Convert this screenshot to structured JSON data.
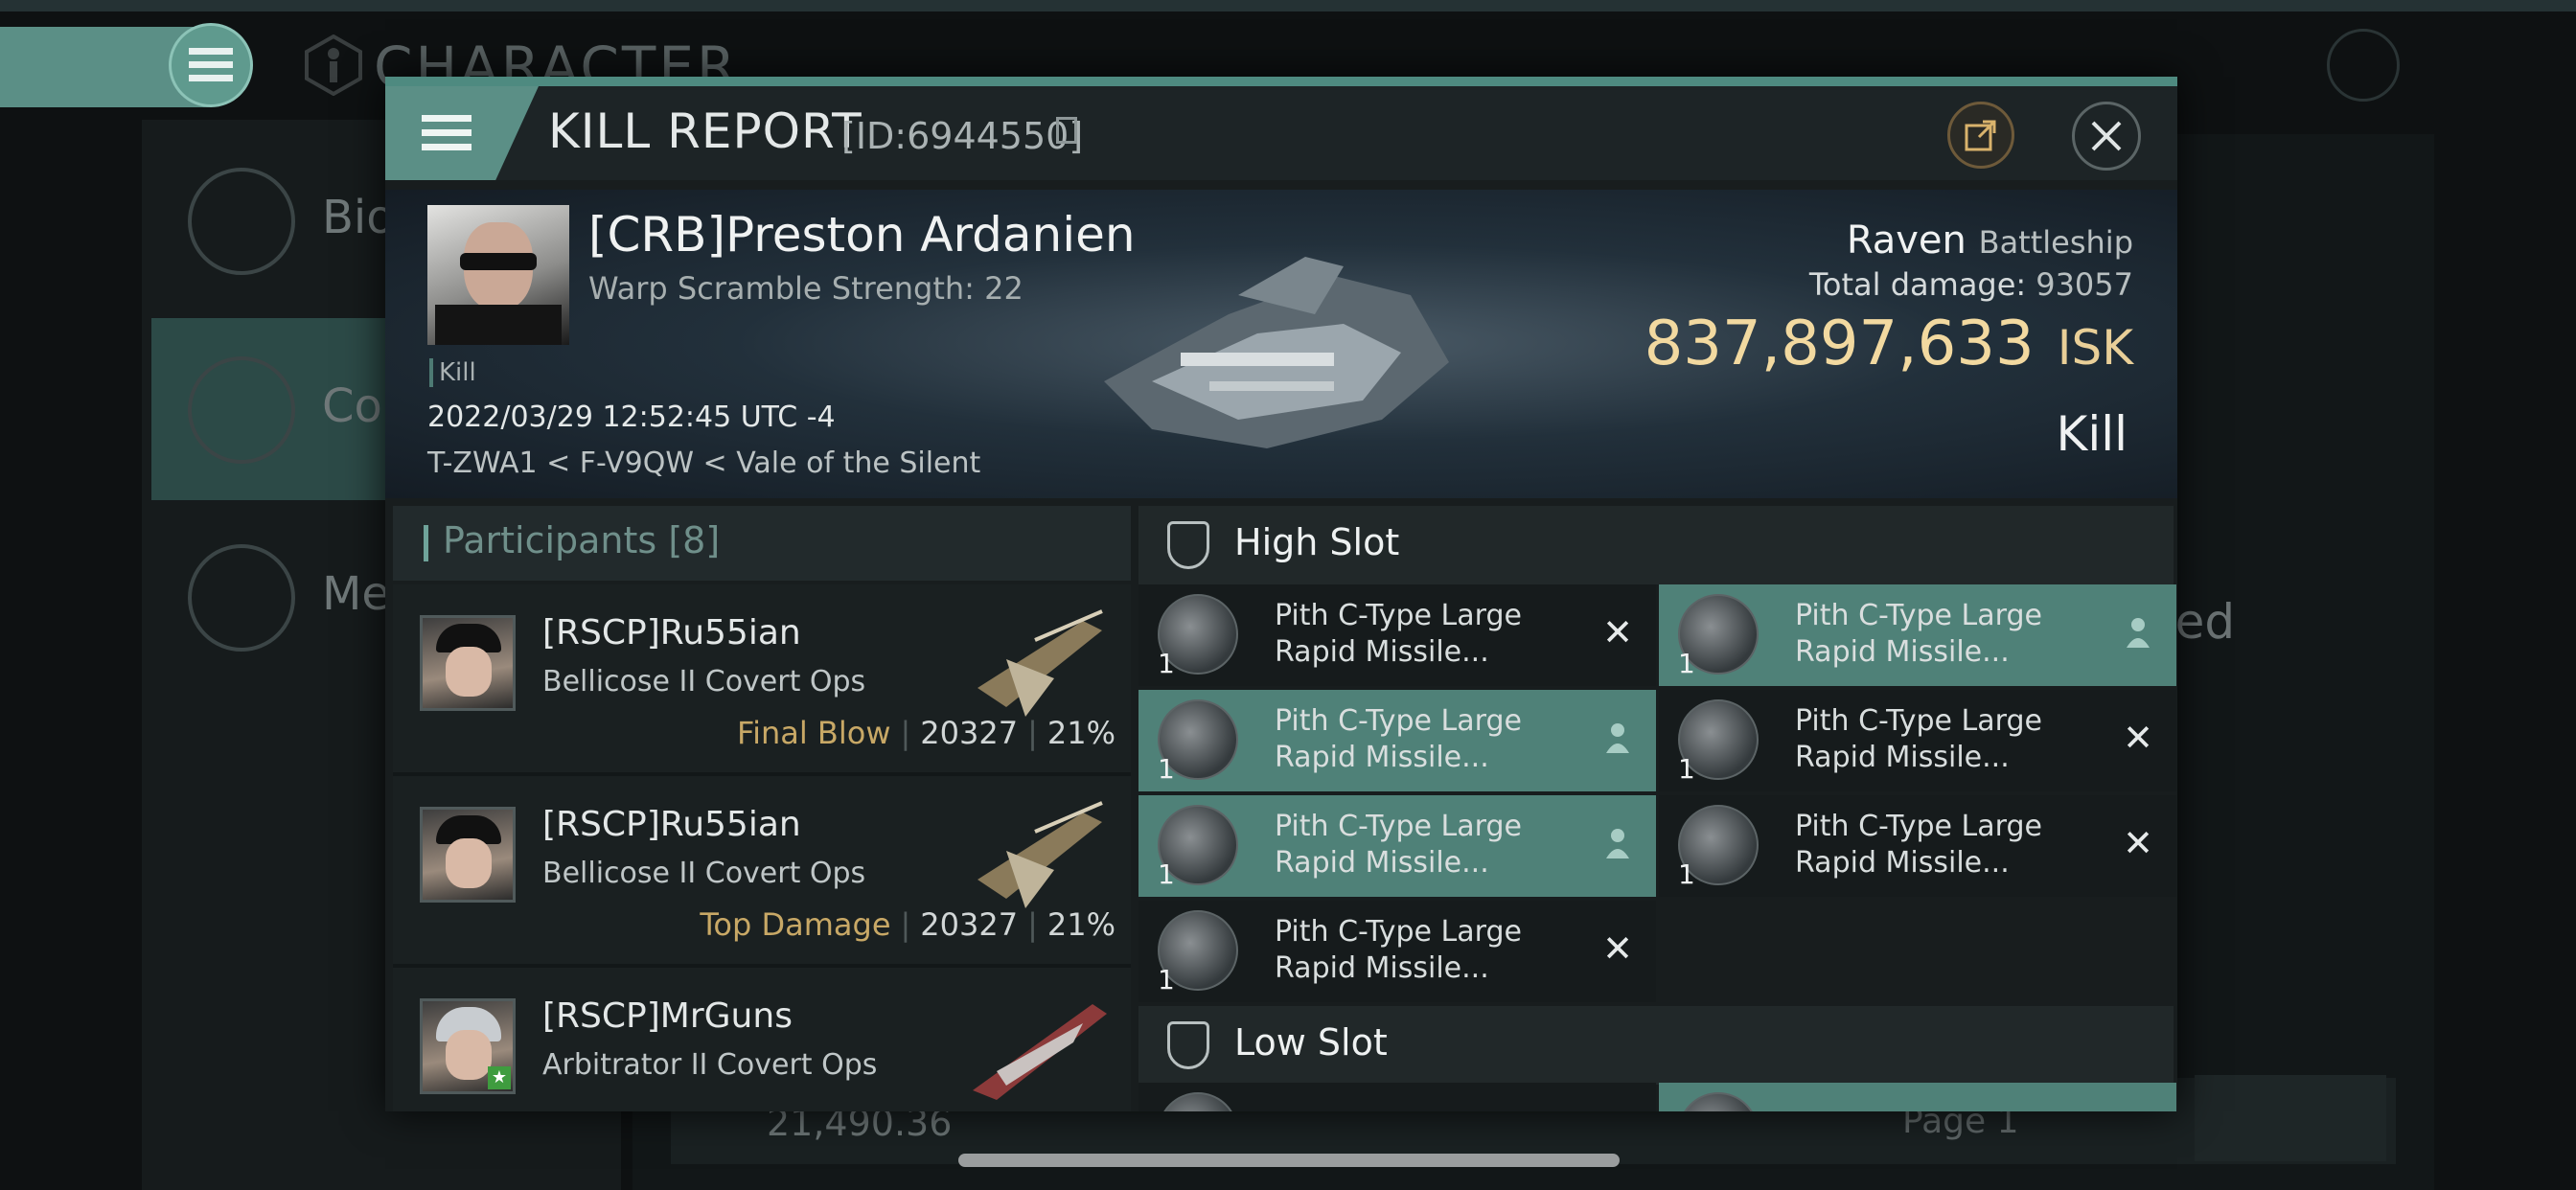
{
  "background": {
    "title": "CHARACTER",
    "sidebar": [
      {
        "label": "Bio"
      },
      {
        "label": "Co"
      },
      {
        "label": "Me"
      }
    ],
    "main_text": "ted",
    "balance": "21,490.36",
    "page": "Page 1"
  },
  "kill_report": {
    "title": "KILL REPORT",
    "id": "[ID:6944550]",
    "victim": {
      "name": "[CRB]Preston Ardanien",
      "warp_scramble": "Warp Scramble Strength: 22",
      "tag": "Kill",
      "date": "2022/03/29 12:52:45 UTC -4",
      "location": "T-ZWA1 < F-V9QW < Vale of the Silent",
      "ship": "Raven",
      "ship_class": "Battleship",
      "total_damage_label": "Total damage:",
      "total_damage": "93057",
      "isk_value": "837,897,633",
      "isk_unit": "ISK",
      "result": "Kill"
    },
    "participants": {
      "label": "Participants",
      "count": "[8]",
      "items": [
        {
          "name": "[RSCP]Ru55ian",
          "ship": "Bellicose II Covert Ops",
          "tag": "Final Blow",
          "damage": "20327",
          "percent": "21%"
        },
        {
          "name": "[RSCP]Ru55ian",
          "ship": "Bellicose II Covert Ops",
          "tag": "Top Damage",
          "damage": "20327",
          "percent": "21%"
        },
        {
          "name": "[RSCP]MrGuns",
          "ship": "Arbitrator II Covert Ops",
          "tag": "",
          "damage": "",
          "percent": ""
        }
      ]
    },
    "high_slot": {
      "title": "High Slot",
      "items": [
        {
          "qty": "1",
          "name": "Pith C-Type Large Rapid Missile...",
          "status": "destroyed"
        },
        {
          "qty": "1",
          "name": "Pith C-Type Large Rapid Missile...",
          "status": "dropped"
        },
        {
          "qty": "1",
          "name": "Pith C-Type Large Rapid Missile...",
          "status": "dropped"
        },
        {
          "qty": "1",
          "name": "Pith C-Type Large Rapid Missile...",
          "status": "destroyed"
        },
        {
          "qty": "1",
          "name": "Pith C-Type Large Rapid Missile...",
          "status": "dropped"
        },
        {
          "qty": "1",
          "name": "Pith C-Type Large Rapid Missile...",
          "status": "destroyed"
        },
        {
          "qty": "1",
          "name": "Pith C-Type Large Rapid Missile...",
          "status": "destroyed"
        }
      ]
    },
    "low_slot": {
      "title": "Low Slot"
    }
  },
  "icons": {
    "menu": "hamburger-icon",
    "share": "share-icon",
    "close": "close-icon",
    "copy": "copy-icon",
    "destroyed": "x-icon",
    "dropped": "person-icon"
  },
  "colors": {
    "accent": "#5b8f86",
    "isk": "#f2d9a0",
    "tag": "#c8a866",
    "dropped_bg": "#4f8178"
  }
}
